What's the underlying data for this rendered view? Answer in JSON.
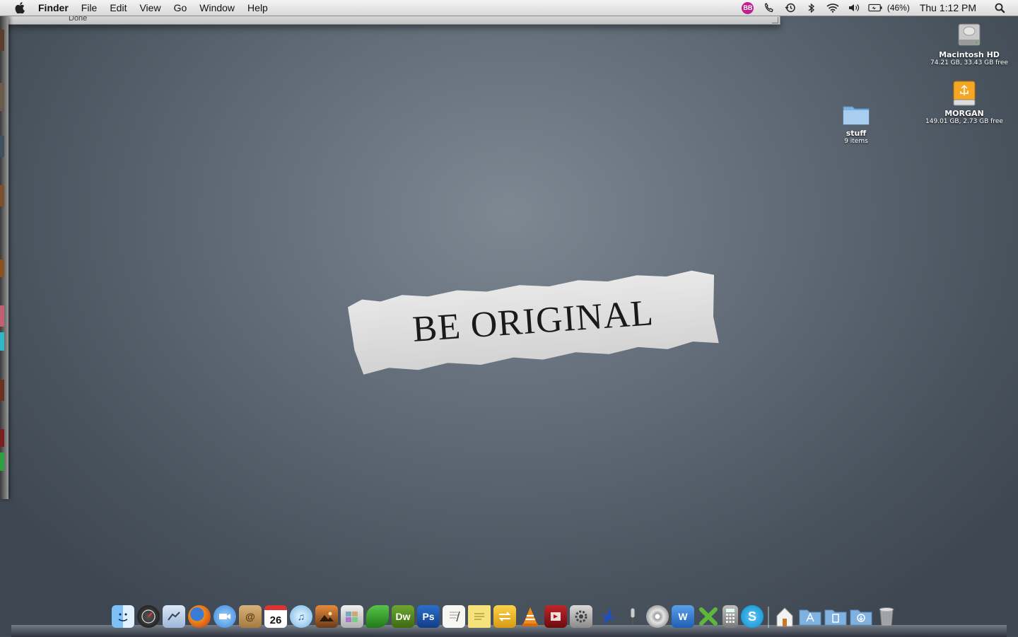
{
  "menubar": {
    "app_name": "Finder",
    "menus": [
      "File",
      "Edit",
      "View",
      "Go",
      "Window",
      "Help"
    ],
    "bb_badge": "BB",
    "battery_percent": "(46%)",
    "clock": "Thu 1:12 PM"
  },
  "background_window": {
    "status": "Done"
  },
  "wallpaper": {
    "text": "BE ORIGINAL"
  },
  "desktop_icons": {
    "macintosh_hd": {
      "name": "Macintosh HD",
      "info": "74.21 GB, 33.43 GB free"
    },
    "morgan": {
      "name": "MORGAN",
      "info": "149.01 GB, 2.73 GB free"
    },
    "stuff": {
      "name": "stuff",
      "info": "9 items"
    }
  },
  "dock": {
    "calendar_day": "26",
    "dreamweaver_label": "Dw",
    "photoshop_label": "Ps",
    "items": [
      "finder-icon",
      "dashboard-icon",
      "mail-icon",
      "firefox-icon",
      "ichat-icon",
      "address-book-icon",
      "ical-icon",
      "itunes-icon",
      "iphoto-icon",
      "photo-booth-icon",
      "preview-icon",
      "coda-icon",
      "dreamweaver-icon",
      "photoshop-icon",
      "textedit-icon",
      "stickies-icon",
      "transfer-icon",
      "vlc-icon",
      "flip4mac-icon",
      "system-preferences-icon",
      "blue-bird-icon",
      "microphone-icon",
      "dvd-player-icon",
      "word-icon",
      "excel-icon",
      "calculator-icon",
      "skype-icon",
      "home-folder-icon",
      "applications-folder-icon",
      "documents-folder-icon",
      "downloads-folder-icon",
      "trash-icon"
    ]
  }
}
